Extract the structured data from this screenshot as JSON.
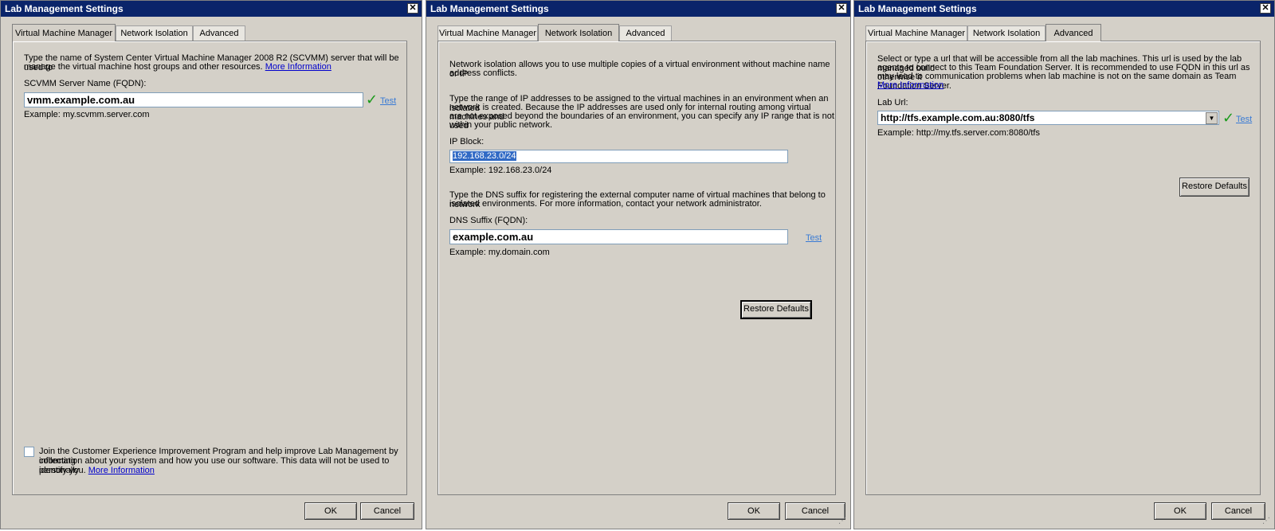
{
  "dialog1": {
    "title": "Lab Management Settings",
    "tabs": [
      "Virtual Machine Manager",
      "Network Isolation",
      "Advanced"
    ],
    "description": "Type the name of System Center Virtual Machine Manager 2008 R2 (SCVMM) server that will be used to",
    "description2": "manage the virtual machine host groups and other resources.",
    "more_info": "More Information",
    "server_label": "SCVMM Server Name (FQDN):",
    "server_value": "vmm.example.com.au",
    "test_link": "Test",
    "example": "Example: my.scvmm.server.com",
    "ceip_line1": "Join the Customer Experience Improvement Program and help improve Lab Management by collecting",
    "ceip_line2": "information about your system and how you use our software. This data will not be used to personally",
    "ceip_line3": "identify you.",
    "ceip_more_info": "More Information",
    "ok": "OK",
    "cancel": "Cancel"
  },
  "dialog2": {
    "title": "Lab Management Settings",
    "tabs": [
      "Virtual Machine Manager",
      "Network Isolation",
      "Advanced"
    ],
    "intro1": "Network isolation allows you to use multiple copies of a virtual environment without machine name or IP",
    "intro2": "address conflicts.",
    "ip_desc1": "Type the range of IP addresses to be assigned to the virtual machines in an environment when an isolated",
    "ip_desc2": "network is created. Because the IP addresses are used only for internal routing among virtual machines and",
    "ip_desc3": "are not exposed beyond the boundaries of an environment, you can specify any IP range that is not used",
    "ip_desc4": "within your public network.",
    "ip_label": "IP Block:",
    "ip_value": "192.168.23.0/24",
    "ip_example": "Example: 192.168.23.0/24",
    "dns_desc1": "Type the DNS suffix for registering the external computer name of virtual machines that belong to network",
    "dns_desc2": "isolated environments. For more information, contact your network administrator.",
    "dns_label": "DNS Suffix (FQDN):",
    "dns_value": "example.com.au",
    "test_link": "Test",
    "dns_example": "Example: my.domain.com",
    "restore": "Restore Defaults",
    "ok": "OK",
    "cancel": "Cancel"
  },
  "dialog3": {
    "title": "Lab Management Settings",
    "tabs": [
      "Virtual Machine Manager",
      "Network Isolation",
      "Advanced"
    ],
    "desc1": "Select or type a url that will be accessible from all the lab machines. This url is used by the lab managed build",
    "desc2": "agents to connect to this Team Foundation Server. It is recommended to use FQDN in this url as otherwise it",
    "desc3": "may lead to communication problems when lab machine is not on the same domain as Team Foundation Server.",
    "more_info": "More Information",
    "url_label": "Lab Url:",
    "url_value": "http://tfs.example.com.au:8080/tfs",
    "test_link": "Test",
    "example": "Example: http://my.tfs.server.com:8080/tfs",
    "restore": "Restore Defaults",
    "ok": "OK",
    "cancel": "Cancel"
  },
  "colors": {
    "titlebar": "#0a246a",
    "dialog_bg": "#d4d0c8",
    "check": "#1a9a1a",
    "link": "#0000cc"
  }
}
